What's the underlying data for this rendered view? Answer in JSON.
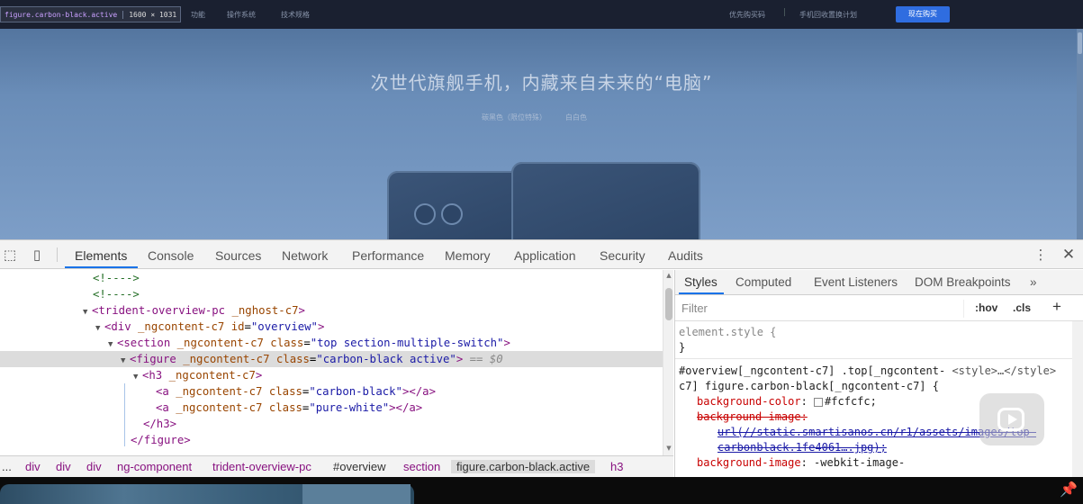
{
  "site": {
    "inspect_tag": "figure.carbon-black.active",
    "inspect_dim": "1600 × 1031",
    "nav": [
      "功能",
      "操作系统",
      "技术规格"
    ],
    "nav_right": [
      "优先购买码",
      "手机回收置换计划"
    ],
    "buy_button": "现在购买",
    "hero_title": "次世代旗舰手机，内藏来自未来的“电脑”",
    "hero_sub_1": "碳黑色（限位特殊）",
    "hero_sub_2": "白白色"
  },
  "devtools": {
    "tabs": [
      "Elements",
      "Console",
      "Sources",
      "Network",
      "Performance",
      "Memory",
      "Application",
      "Security",
      "Audits"
    ],
    "active_tab": "Elements",
    "icons": {
      "inspect": "cursor-select-icon",
      "device": "device-toggle-icon",
      "more": "kebab-menu-icon",
      "close": "close-icon"
    },
    "tree": {
      "comment1": "<!---->",
      "comment2": "<!---->",
      "row3_tag": "trident-overview-pc",
      "row3_attr": "_nghost-c7",
      "row4_tag": "div",
      "row4_attr1": "_ngcontent-c7",
      "row4_attr2": "id",
      "row4_val2": "\"overview\"",
      "row5_tag": "section",
      "row5_attr1": "_ngcontent-c7",
      "row5_attr2": "class",
      "row5_val2": "\"top section-multiple-switch\"",
      "row6_tag": "figure",
      "row6_attr1": "_ngcontent-c7",
      "row6_attr2": "class",
      "row6_val2": "\"carbon-black active\"",
      "row6_ref": "== $0",
      "row7_tag": "h3",
      "row7_attr1": "_ngcontent-c7",
      "row8_tag": "a",
      "row8_attr1": "_ngcontent-c7",
      "row8_attr2": "class",
      "row8_val2": "\"carbon-black\"",
      "row9_tag": "a",
      "row9_attr1": "_ngcontent-c7",
      "row9_attr2": "class",
      "row9_val2": "\"pure-white\"",
      "row10_close": "</h3>",
      "row11_close": "</figure>"
    },
    "breadcrumbs": [
      "...",
      "div",
      "div",
      "div",
      "ng-component",
      "trident-overview-pc",
      "#overview",
      "section",
      "figure.carbon-black.active",
      "h3"
    ],
    "styles_tabs": [
      "Styles",
      "Computed",
      "Event Listeners",
      "DOM Breakpoints",
      "»"
    ],
    "filter_placeholder": "Filter",
    "filter_hov": ":hov",
    "filter_cls": ".cls",
    "filter_add": "+",
    "css": {
      "element_style": "element.style {",
      "element_close": "}",
      "rule_selector_1": "#overview[_ngcontent-c7] .top[_ngcontent-",
      "rule_source": "<style>…</style>",
      "rule_selector_2": "c7] figure.carbon-black[_ngcontent-c7] {",
      "bg_color_prop": "background-color",
      "bg_color_val": "#fcfcfc;",
      "bg_image_prop": "background-image",
      "bg_image_url_1": "url(//static.smartisanos.cn/r1/assets/images/top-",
      "bg_image_url_2": "carbonblack.1fe4061….jpg);",
      "bg_image_prop2": "background-image",
      "bg_image_val2": "-webkit-image-"
    }
  }
}
